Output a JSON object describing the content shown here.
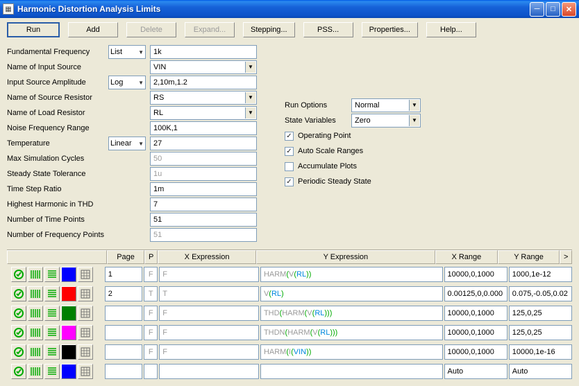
{
  "title": "Harmonic Distortion Analysis Limits",
  "buttons": {
    "run": "Run",
    "add": "Add",
    "delete": "Delete",
    "expand": "Expand...",
    "stepping": "Stepping...",
    "pss": "PSS...",
    "properties": "Properties...",
    "help": "Help..."
  },
  "left": {
    "fundamental_freq": {
      "label": "Fundamental Frequency",
      "mode": "List",
      "value": "1k"
    },
    "input_source": {
      "label": "Name of Input Source",
      "value": "VIN"
    },
    "input_amp": {
      "label": "Input Source Amplitude",
      "mode": "Log",
      "value": "2,10m,1.2"
    },
    "src_resistor": {
      "label": "Name of Source Resistor",
      "value": "RS"
    },
    "load_resistor": {
      "label": "Name of Load Resistor",
      "value": "RL"
    },
    "noise_freq": {
      "label": "Noise Frequency Range",
      "value": "100K,1"
    },
    "temperature": {
      "label": "Temperature",
      "mode": "Linear",
      "value": "27"
    },
    "max_sim": {
      "label": "Max Simulation Cycles",
      "value": "50"
    },
    "ss_tol": {
      "label": "Steady State Tolerance",
      "value": "1u"
    },
    "time_step": {
      "label": "Time Step Ratio",
      "value": "1m"
    },
    "highest_harm": {
      "label": "Highest Harmonic in THD",
      "value": "7"
    },
    "num_time": {
      "label": "Number of Time Points",
      "value": "51"
    },
    "num_freq": {
      "label": "Number of Frequency Points",
      "value": "51"
    }
  },
  "right": {
    "run_options": {
      "label": "Run Options",
      "value": "Normal"
    },
    "state_vars": {
      "label": "State Variables",
      "value": "Zero"
    },
    "op_point": {
      "label": "Operating Point",
      "checked": true
    },
    "auto_scale": {
      "label": "Auto Scale Ranges",
      "checked": true
    },
    "accum": {
      "label": "Accumulate Plots",
      "checked": false
    },
    "pss": {
      "label": "Periodic Steady State",
      "checked": true
    }
  },
  "tbl": {
    "headers": {
      "page": "Page",
      "p": "P",
      "xexp": "X Expression",
      "yexp": "Y Expression",
      "xr": "X Range",
      "yr": "Y Range",
      "more": ">"
    },
    "rows": [
      {
        "color": "#0000ff",
        "page": "1",
        "p": "F",
        "xexp": "F",
        "yexp": [
          "HARM(",
          "V(",
          "RL",
          ")",
          ")"
        ],
        "xr": "10000,0,1000",
        "yr": "1000,1e-12"
      },
      {
        "color": "#ff0000",
        "page": "2",
        "p": "T",
        "xexp": "T",
        "yexp": [
          "V(",
          "RL",
          ")"
        ],
        "xr": "0.00125,0,0.000",
        "yr": "0.075,-0.05,0.02"
      },
      {
        "color": "#008000",
        "page": "",
        "p": "F",
        "xexp": "F",
        "yexp": [
          "THD(",
          "HARM(",
          "V(",
          "RL",
          ")",
          ")",
          ")"
        ],
        "xr": "10000,0,1000",
        "yr": "125,0,25"
      },
      {
        "color": "#ff00ff",
        "page": "",
        "p": "F",
        "xexp": "F",
        "yexp": [
          "THDN(",
          "HARM(",
          "V(",
          "RL",
          ")",
          ")",
          ")"
        ],
        "xr": "10000,0,1000",
        "yr": "125,0,25"
      },
      {
        "color": "#000000",
        "page": "",
        "p": "F",
        "xexp": "F",
        "yexp": [
          "HARM(",
          "I(",
          "VIN",
          ")",
          ")"
        ],
        "xr": "10000,0,1000",
        "yr": "10000,1e-16"
      },
      {
        "color": "#0000ff",
        "page": "",
        "p": "",
        "xexp": "",
        "yexp": [],
        "xr": "Auto",
        "yr": "Auto"
      }
    ]
  }
}
